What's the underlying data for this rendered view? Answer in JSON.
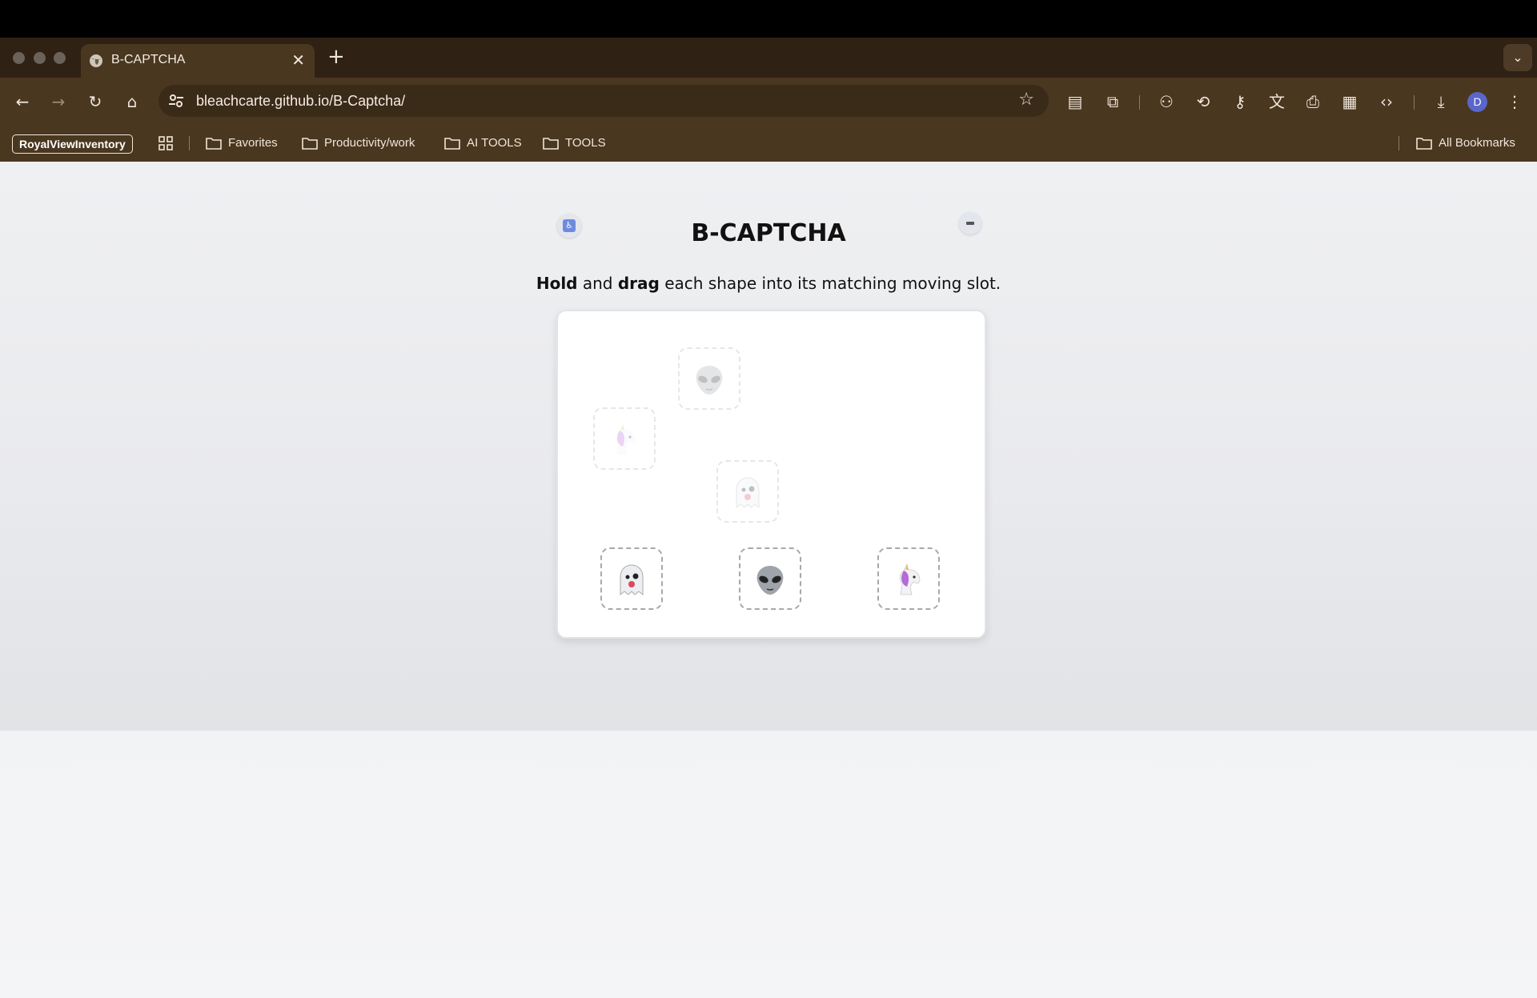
{
  "browser": {
    "tab_title": "B-CAPTCHA",
    "url": "bleachcarte.github.io/B-Captcha/",
    "avatar_initial": "D",
    "bookmarks": {
      "chip": "RoyalViewInventory",
      "folders": [
        "Favorites",
        "Productivity/work",
        "AI TOOLS",
        "TOOLS"
      ],
      "all_bookmarks": "All Bookmarks"
    }
  },
  "captcha": {
    "title": "B-CAPTCHA",
    "instruction": {
      "hold": "Hold",
      "and": "and",
      "drag": "drag",
      "rest": "each shape into its matching moving slot."
    },
    "slots": [
      "alien",
      "unicorn",
      "ghost"
    ],
    "pieces": [
      "ghost",
      "alien",
      "unicorn"
    ]
  }
}
